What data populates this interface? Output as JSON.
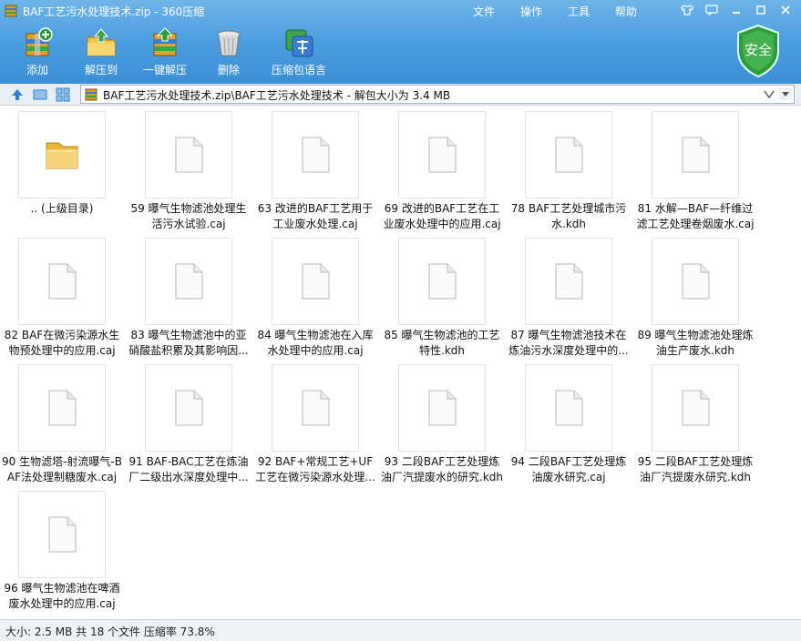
{
  "window": {
    "title": "BAF工艺污水处理技术.zip - 360压缩"
  },
  "menu": [
    "文件",
    "操作",
    "工具",
    "帮助"
  ],
  "toolbar": {
    "add": "添加",
    "extract_to": "解压到",
    "one_click_extract": "一键解压",
    "delete": "删除",
    "archive_language": "压缩包语言"
  },
  "security_badge": "安全",
  "address": {
    "path": "BAF工艺污水处理技术.zip\\BAF工艺污水处理技术 - 解包大小为 3.4 MB"
  },
  "files": [
    {
      "name": ".. (上级目录)",
      "type": "folder"
    },
    {
      "name": "59  曝气生物滤池处理生活污水试验.caj",
      "type": "file"
    },
    {
      "name": "63  改进的BAF工艺用于工业废水处理.caj",
      "type": "file"
    },
    {
      "name": "69  改进的BAF工艺在工业废水处理中的应用.caj",
      "type": "file"
    },
    {
      "name": "78  BAF工艺处理城市污水.kdh",
      "type": "file"
    },
    {
      "name": "81  水解—BAF—纤维过滤工艺处理卷烟废水.caj",
      "type": "file"
    },
    {
      "name": "82  BAF在微污染源水生物预处理中的应用.caj",
      "type": "file"
    },
    {
      "name": "83  曝气生物滤池中的亚硝酸盐积累及其影响因...",
      "type": "file"
    },
    {
      "name": "84  曝气生物滤池在入库水处理中的应用.caj",
      "type": "file"
    },
    {
      "name": "85  曝气生物滤池的工艺特性.kdh",
      "type": "file"
    },
    {
      "name": "87  曝气生物滤池技术在炼油污水深度处理中的...",
      "type": "file"
    },
    {
      "name": "89  曝气生物滤池处理炼油生产废水.kdh",
      "type": "file"
    },
    {
      "name": "90  生物滤塔-射流曝气-BAF法处理制糖废水.caj",
      "type": "file"
    },
    {
      "name": "91  BAF-BAC工艺在炼油厂二级出水深度处理中...",
      "type": "file"
    },
    {
      "name": "92  BAF+常规工艺+UF工艺在微污染源水处理...",
      "type": "file"
    },
    {
      "name": "93  二段BAF工艺处理炼油厂汽提废水的研究.kdh",
      "type": "file"
    },
    {
      "name": "94  二段BAF工艺处理炼油废水研究.caj",
      "type": "file"
    },
    {
      "name": "95  二段BAF工艺处理炼油厂汽提废水研究.kdh",
      "type": "file"
    },
    {
      "name": "96  曝气生物滤池在啤酒废水处理中的应用.caj",
      "type": "file"
    }
  ],
  "status": {
    "text": "大小: 2.5 MB 共 18 个文件 压缩率 73.8%"
  }
}
